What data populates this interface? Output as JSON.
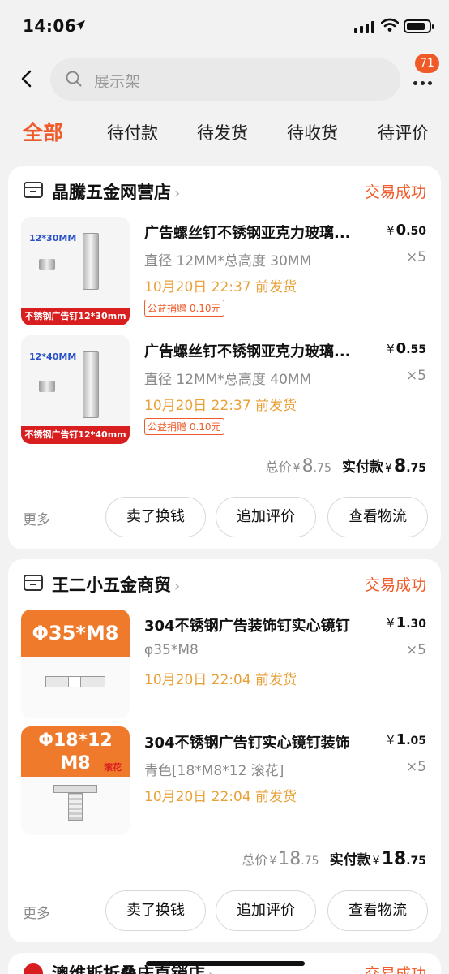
{
  "status_bar": {
    "time": "14:06"
  },
  "search": {
    "placeholder": "展示架",
    "badge": "71"
  },
  "tabs": [
    {
      "label": "全部",
      "active": true
    },
    {
      "label": "待付款"
    },
    {
      "label": "待发货"
    },
    {
      "label": "待收货"
    },
    {
      "label": "待评价"
    }
  ],
  "orders": [
    {
      "shop": "晶騰五金网营店",
      "status": "交易成功",
      "items": [
        {
          "title": "广告螺丝钉不锈钢亚克力玻璃...",
          "price_int": "0",
          "price_dec": ".50",
          "spec": "直径 12MM*总高度 30MM",
          "qty": "×5",
          "ship": "10月20日 22:37 前发货",
          "charity": "公益捐赠 0.10元",
          "img_label": "12*30MM",
          "img_banner": "不锈钢广告钉12*30mm"
        },
        {
          "title": "广告螺丝钉不锈钢亚克力玻璃...",
          "price_int": "0",
          "price_dec": ".55",
          "spec": "直径 12MM*总高度 40MM",
          "qty": "×5",
          "ship": "10月20日 22:37 前发货",
          "charity": "公益捐赠 0.10元",
          "img_label": "12*40MM",
          "img_banner": "不锈钢广告钉12*40mm"
        }
      ],
      "total_label": "总价",
      "total_int": "8",
      "total_dec": ".75",
      "paid_label": "实付款",
      "paid_int": "8",
      "paid_dec": ".75",
      "more": "更多",
      "actions": [
        "卖了换钱",
        "追加评价",
        "查看物流"
      ]
    },
    {
      "shop": "王二小五金商贸",
      "status": "交易成功",
      "items": [
        {
          "title": "304不锈钢广告装饰钉实心镜钉",
          "price_int": "1",
          "price_dec": ".30",
          "spec": "φ35*M8",
          "qty": "×5",
          "ship": "10月20日 22:04 前发货",
          "img_label": "Φ35*M8"
        },
        {
          "title": "304不锈钢广告钉实心镜钉装饰",
          "price_int": "1",
          "price_dec": ".05",
          "spec": "青色[18*M8*12 滚花]",
          "qty": "×5",
          "ship": "10月20日 22:04 前发货",
          "img_label_1": "Φ18*12",
          "img_label_2": "M8",
          "img_tag": "滚花"
        }
      ],
      "total_label": "总价",
      "total_int": "18",
      "total_dec": ".75",
      "paid_label": "实付款",
      "paid_int": "18",
      "paid_dec": ".75",
      "more": "更多",
      "actions": [
        "卖了换钱",
        "追加评价",
        "查看物流"
      ]
    },
    {
      "shop": "澳维斯折叠床直销店",
      "status": "交易成功"
    }
  ],
  "currency": "¥",
  "colors": {
    "accent": "#f05a28",
    "ship": "#e8a13b"
  }
}
